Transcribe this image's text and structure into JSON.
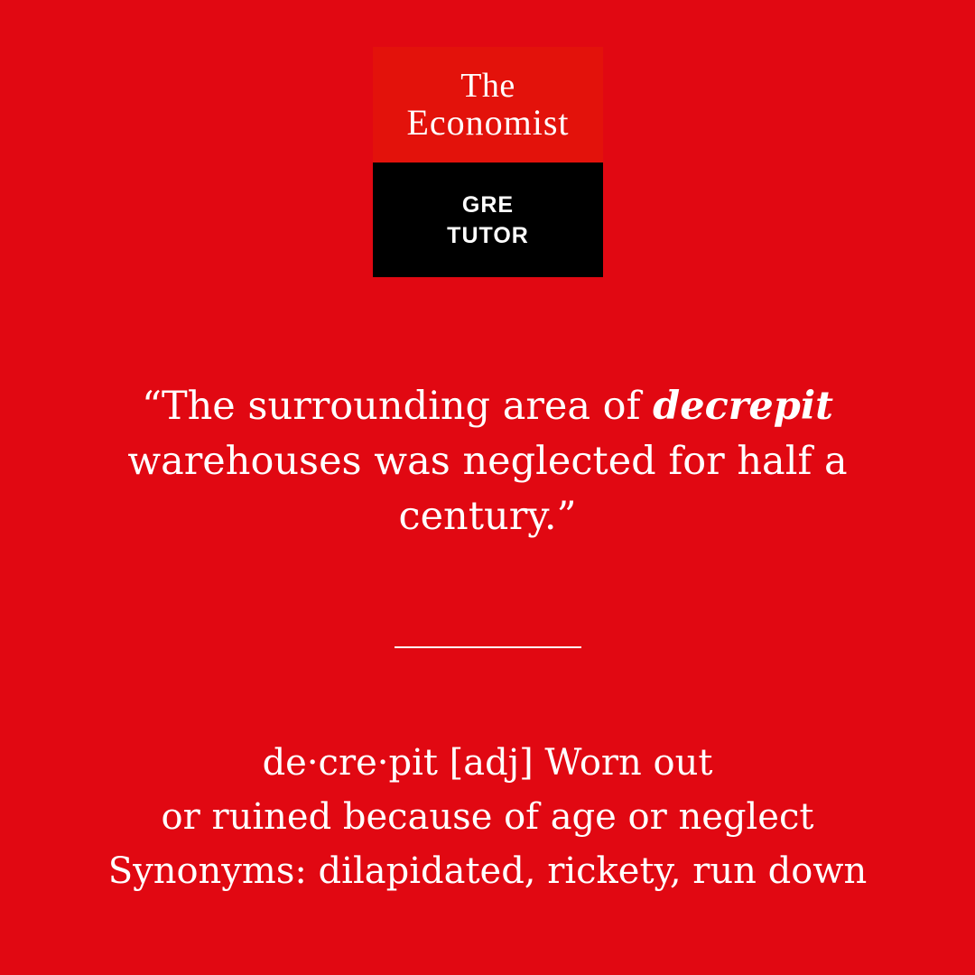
{
  "brand": {
    "line1": "The",
    "line2": "Economist",
    "sub_line1": "GRE",
    "sub_line2": "TUTOR"
  },
  "quote": {
    "open_mark": "“",
    "before": "The surrounding area of ",
    "word": "decrepit",
    "after": " warehouses was neglected for half a century.",
    "close_mark": "”"
  },
  "definition": {
    "line1": "de·cre·pit [adj] Worn out",
    "line2": "or ruined because of age or neglect",
    "line3": "Synonyms: dilapidated, rickety, run down"
  },
  "colors": {
    "background": "#e10812",
    "logo_red": "#e3120b",
    "logo_black": "#000000",
    "text": "#ffffff"
  }
}
